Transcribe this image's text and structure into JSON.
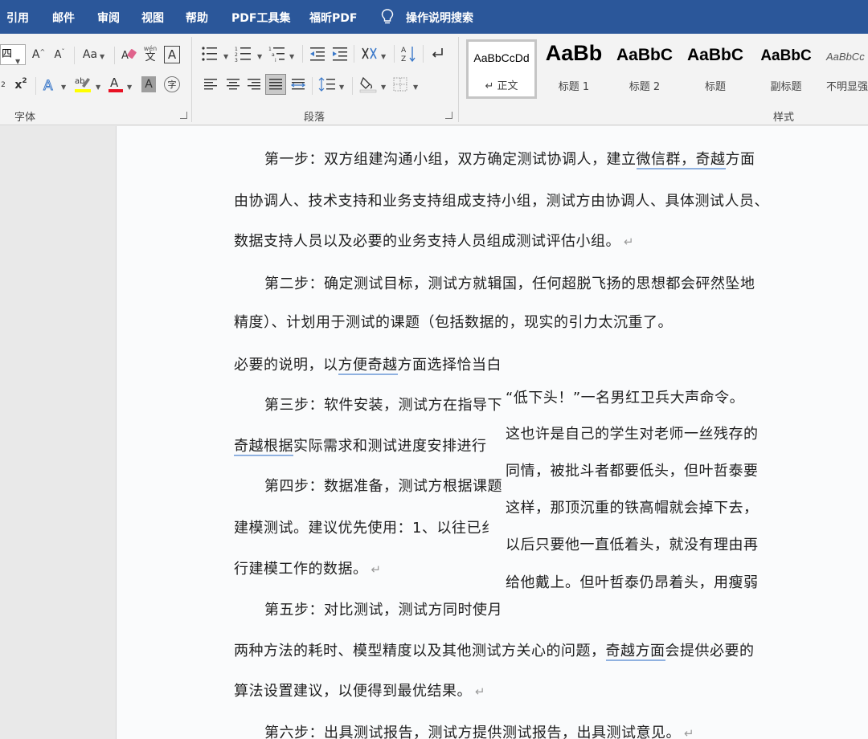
{
  "menu": {
    "items": [
      "引用",
      "邮件",
      "审阅",
      "视图",
      "帮助",
      "PDF工具集",
      "福昕PDF"
    ],
    "search_label": "操作说明搜索"
  },
  "ribbon": {
    "font_size_value": "四",
    "font_group_label": "字体",
    "paragraph_group_label": "段落",
    "styles_group_label": "样式",
    "change_case_label": "Aa",
    "phonetic_top": "wén",
    "phonetic_bottom": "文",
    "enclosed_char": "字",
    "char_border": "A",
    "char_shading": "A",
    "subscript_base": "x",
    "subscript_mark": "2",
    "superscript_base": "x",
    "superscript_mark": "2",
    "grow_font": "A",
    "shrink_font": "A"
  },
  "styles": [
    {
      "sample": "AaBbCcDd",
      "name": "↵ 正文",
      "selected": true
    },
    {
      "sample": "AaBb",
      "name": "标题 1"
    },
    {
      "sample": "AaBbC",
      "name": "标题 2"
    },
    {
      "sample": "AaBbC",
      "name": "标题"
    },
    {
      "sample": "AaBbC",
      "name": "副标题"
    },
    {
      "sample": "AaBbCc",
      "name": "不明显强"
    }
  ],
  "document": {
    "lines": [
      [
        "第一步：双方组建沟通小组，双方确定测试协调人，建立",
        {
          "u": "微信群，奇越"
        },
        "方面"
      ],
      [
        "由协调人、技术支持和业务支持组成支持小组，测试方由协调人、具体测试人员、"
      ],
      [
        "数据支持人员以及必要的业务支持人员组成测试评估小组。"
      ],
      [
        "第二步：确定测试目标，测试方就辑国，任何超脱飞扬的思想都会砰然坠地"
      ],
      [
        "精度）、计划用于测试的课题（包括数据的，现实的引力太沉重了。"
      ],
      [
        "必要的说明，以",
        {
          "u": "方便奇越"
        },
        "方面选择恰当白"
      ],
      [
        "第三步：软件安装，测试方在指导下"
      ],
      [
        {
          "u": "奇越根据"
        },
        "实际需求和测试进度安排进行"
      ],
      [
        "第四步：数据准备，测试方根据课题"
      ],
      [
        "建模测试。建议优先使用：1、以往已纟"
      ],
      [
        "行建模工作的数据。"
      ],
      [
        "第五步：对比测试，测试方同时使月"
      ],
      [
        "两种方法的耗时、模型精度以及其他测试方关心的问题，",
        {
          "u": "奇越方面"
        },
        "会提供必要的"
      ],
      [
        "算法设置建议，以便得到最优结果。"
      ],
      [
        "第六步：出具测试报告，测试方提供测试报告，出具测试意见。"
      ]
    ],
    "overlay_lines": [
      "“低下头！”一名男红卫兵大声命令。",
      "这也许是自己的学生对老师一丝残存的",
      "同情，被批斗者都要低头，但叶哲泰要",
      "这样，那顶沉重的铁高帽就会掉下去，",
      "以后只要他一直低着头，就没有理由再",
      "给他戴上。但叶哲泰仍昂着头，用瘦弱"
    ],
    "paragraph_mark": "↵"
  },
  "colors": {
    "menubar": "#2b579a",
    "highlight_yellow": "#ffff00",
    "font_color_red": "#e81123",
    "underline_blue": "#8fb1e0"
  }
}
